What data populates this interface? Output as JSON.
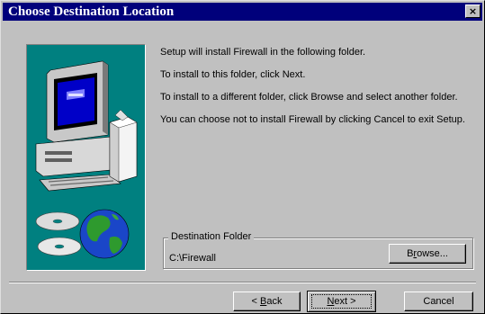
{
  "window": {
    "title": "Choose Destination Location",
    "close_label": "×"
  },
  "messages": [
    "Setup will install Firewall in the following folder.",
    "To install to this folder, click Next.",
    "To install to a different folder, click Browse and select another folder.",
    "You can choose not to install Firewall by clicking Cancel to exit Setup."
  ],
  "destination": {
    "label": "Destination Folder",
    "path": "C:\\Firewall",
    "browse": {
      "pre": "B",
      "key": "r",
      "post": "owse..."
    }
  },
  "buttons": {
    "back": {
      "pre": "< ",
      "key": "B",
      "post": "ack"
    },
    "next": {
      "pre": "",
      "key": "N",
      "post": "ext >"
    },
    "cancel": "Cancel"
  },
  "icons": {
    "illustration": "computer-cd-globe-illustration",
    "close": "close-icon"
  },
  "colors": {
    "titlebar": "#00007b",
    "dialog": "#c0c0c0",
    "illustration_bg": "#008080"
  }
}
